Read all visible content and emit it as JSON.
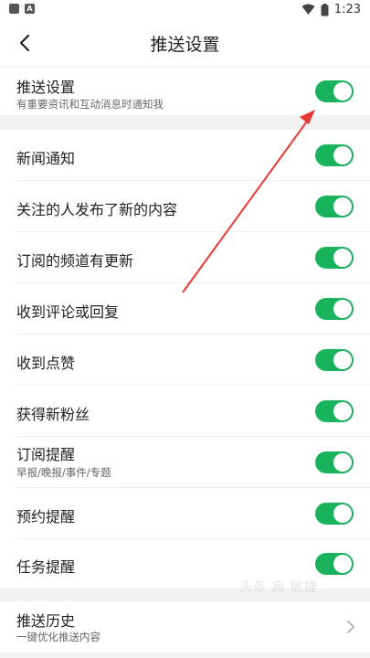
{
  "status_bar": {
    "time": "1:23",
    "left_icons": [
      "notification-square-icon",
      "app-a-icon"
    ],
    "right_icons": [
      "wifi-icon",
      "battery-icon"
    ]
  },
  "header": {
    "title": "推送设置",
    "back_icon": "chevron-left-icon"
  },
  "master_toggle": {
    "label": "推送设置",
    "sub": "有重要资讯和互动消息时通知我",
    "on": true
  },
  "settings": [
    {
      "label": "新闻通知",
      "on": true
    },
    {
      "label": "关注的人发布了新的内容",
      "on": true
    },
    {
      "label": "订阅的频道有更新",
      "on": true
    },
    {
      "label": "收到评论或回复",
      "on": true
    },
    {
      "label": "收到点赞",
      "on": true
    },
    {
      "label": "获得新粉丝",
      "on": true
    },
    {
      "label": "订阅提醒",
      "sub": "早报/晚报/事件/专题",
      "on": true
    },
    {
      "label": "预约提醒",
      "on": true
    },
    {
      "label": "任务提醒",
      "on": true
    }
  ],
  "history": {
    "label": "推送历史",
    "sub": "一键优化推送内容",
    "icon": "chevron-right-icon"
  },
  "watermark": "头条 扁 敏捷",
  "colors": {
    "toggle_on": "#1ab25c",
    "annotation_arrow": "#e53935",
    "section_gap": "#f2f2f2"
  }
}
